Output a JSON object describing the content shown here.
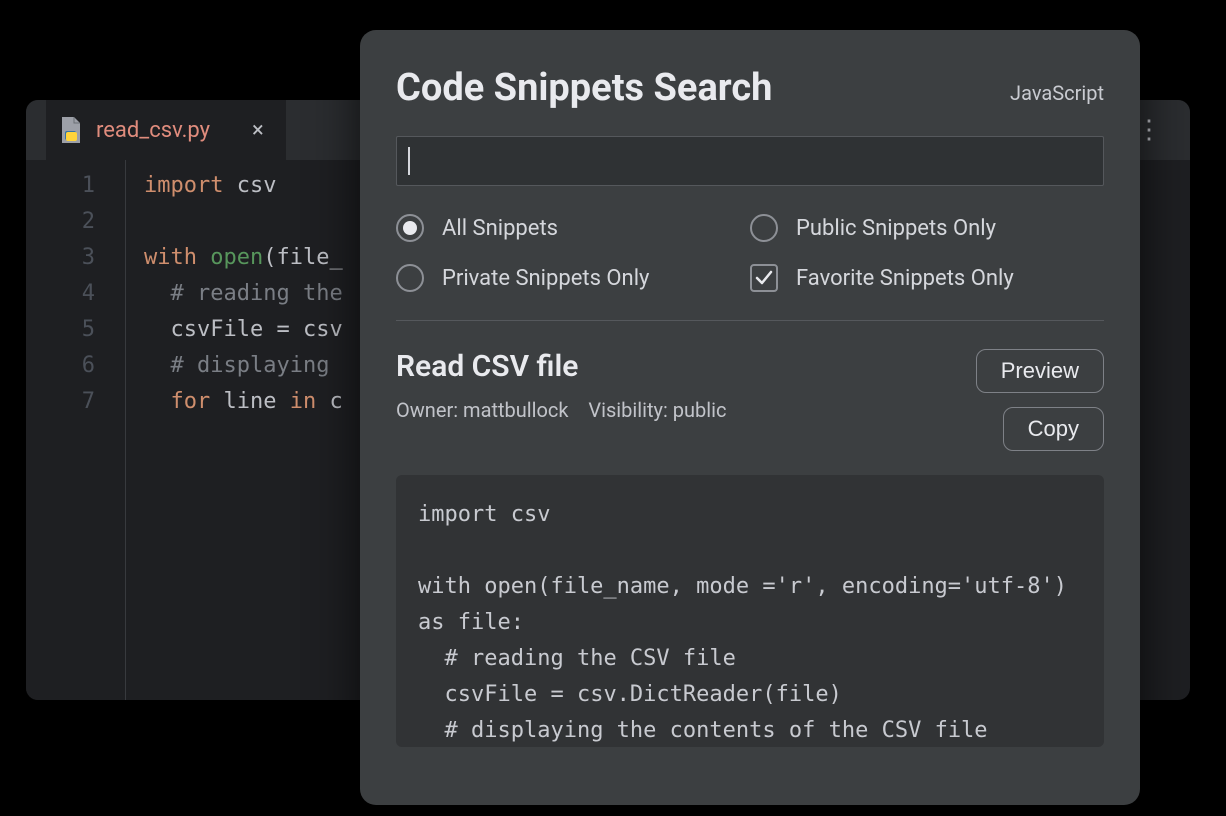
{
  "editor": {
    "tab": {
      "filename": "read_csv.py",
      "close_glyph": "×"
    },
    "gutter": [
      "1",
      "2",
      "3",
      "4",
      "5",
      "6",
      "7"
    ]
  },
  "code": {
    "l1_kw_import": "import",
    "l1_mod": "csv",
    "l3_kw_with": "with",
    "l3_fn_open": "open",
    "l3_arg": "(file_",
    "l4_comment": "# reading the",
    "l5_lhs": "csvFile",
    "l5_eq": " = ",
    "l5_rhs": "csv",
    "l6_comment": "# displaying ",
    "l7_kw_for": "for",
    "l7_var": "line",
    "l7_kw_in": "in",
    "l7_rest": " c"
  },
  "panel": {
    "title": "Code Snippets Search",
    "language": "JavaScript",
    "search_value": "",
    "filters": {
      "all": "All Snippets",
      "public": "Public Snippets Only",
      "private": "Private Snippets Only",
      "favorite": "Favorite Snippets Only",
      "selected_radio": "all",
      "favorite_checked": true
    },
    "result": {
      "title": "Read CSV file",
      "owner_label": "Owner: ",
      "owner": "mattbullock",
      "visibility_label": "Visibility: ",
      "visibility": "public",
      "preview_btn": "Preview",
      "copy_btn": "Copy",
      "code": "import csv\n\nwith open(file_name, mode ='r', encoding='utf-8') as file:\n  # reading the CSV file\n  csvFile = csv.DictReader(file)\n  # displaying the contents of the CSV file"
    }
  }
}
